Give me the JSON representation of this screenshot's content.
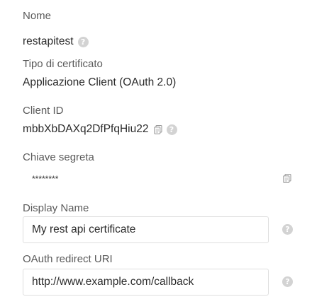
{
  "nome": {
    "label": "Nome",
    "value": "restapitest",
    "help_icon": "question-circle-icon"
  },
  "tipo": {
    "label": "Tipo di certificato",
    "value": "Applicazione Client (OAuth 2.0)"
  },
  "client_id": {
    "label": "Client ID",
    "value": "mbbXbDAXq2DfPfqHiu22",
    "copy_icon": "copy-icon",
    "help_icon": "question-circle-icon"
  },
  "chiave": {
    "label": "Chiave segreta",
    "value": "********",
    "copy_icon": "copy-icon"
  },
  "display_name": {
    "label": "Display Name",
    "value": "My rest api certificate",
    "help_icon": "question-circle-icon"
  },
  "redirect": {
    "label": "OAuth redirect URI",
    "value": "http://www.example.com/callback",
    "help_icon": "question-circle-icon"
  },
  "colors": {
    "help_bg": "#d3d3d3",
    "label_text": "#5a5a5a",
    "value_text": "#2b2b2b",
    "field_border": "#dedede"
  }
}
